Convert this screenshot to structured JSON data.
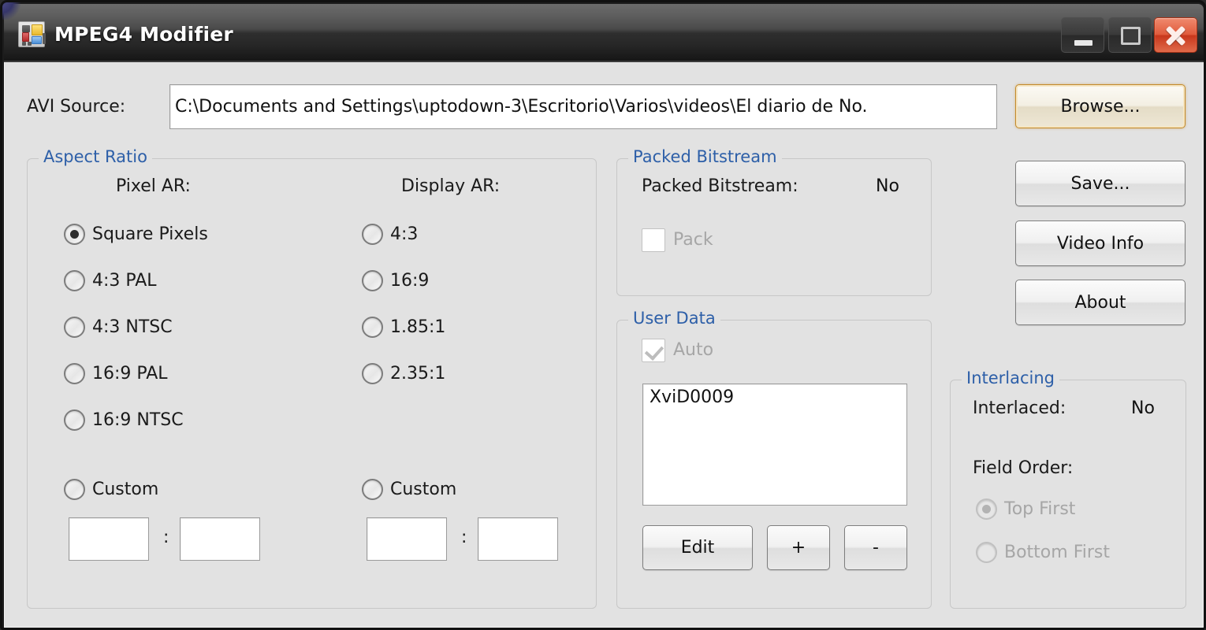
{
  "window": {
    "title": "MPEG4 Modifier",
    "app_icon": "mpeg4-modifier-icon",
    "controls": {
      "minimize": "minimize-icon",
      "maximize": "maximize-icon",
      "close": "close-icon"
    }
  },
  "source": {
    "label": "AVI Source:",
    "path": "C:\\Documents and Settings\\uptodown-3\\Escritorio\\Varios\\videos\\El diario de No.",
    "placeholder": "",
    "browse_label": "Browse..."
  },
  "side_buttons": {
    "save": "Save...",
    "video_info": "Video Info",
    "about": "About"
  },
  "aspect_ratio": {
    "title": "Aspect Ratio",
    "pixel_ar_label": "Pixel AR:",
    "display_ar_label": "Display AR:",
    "pixel_options": [
      {
        "label": "Square Pixels",
        "checked": true
      },
      {
        "label": "4:3 PAL",
        "checked": false
      },
      {
        "label": "4:3 NTSC",
        "checked": false
      },
      {
        "label": "16:9 PAL",
        "checked": false
      },
      {
        "label": "16:9 NTSC",
        "checked": false
      }
    ],
    "display_options": [
      {
        "label": "4:3",
        "checked": false
      },
      {
        "label": "16:9",
        "checked": false
      },
      {
        "label": "1.85:1",
        "checked": false
      },
      {
        "label": "2.35:1",
        "checked": false
      }
    ],
    "pixel_custom": {
      "label": "Custom",
      "checked": false,
      "num": "",
      "den": "",
      "separator": ":"
    },
    "display_custom": {
      "label": "Custom",
      "checked": false,
      "num": "",
      "den": "",
      "separator": ":"
    }
  },
  "packed_bitstream": {
    "title": "Packed Bitstream",
    "status_label": "Packed Bitstream:",
    "status_value": "No",
    "pack_label": "Pack",
    "pack_checked": false,
    "pack_enabled": false
  },
  "user_data": {
    "title": "User Data",
    "auto_label": "Auto",
    "auto_checked": true,
    "auto_enabled": false,
    "entries": [
      "XviD0009"
    ],
    "edit_label": "Edit",
    "add_label": "+",
    "remove_label": "-"
  },
  "interlacing": {
    "title": "Interlacing",
    "interlaced_label": "Interlaced:",
    "interlaced_value": "No",
    "field_order_label": "Field Order:",
    "field_options": [
      {
        "label": "Top First",
        "checked": true
      },
      {
        "label": "Bottom First",
        "checked": false
      }
    ],
    "enabled": false
  },
  "colors": {
    "accent_group_title": "#2d5fa8",
    "window_bg": "#e2e2e2",
    "close_button": "#e05b3c",
    "focus_border": "#c48a2a"
  }
}
